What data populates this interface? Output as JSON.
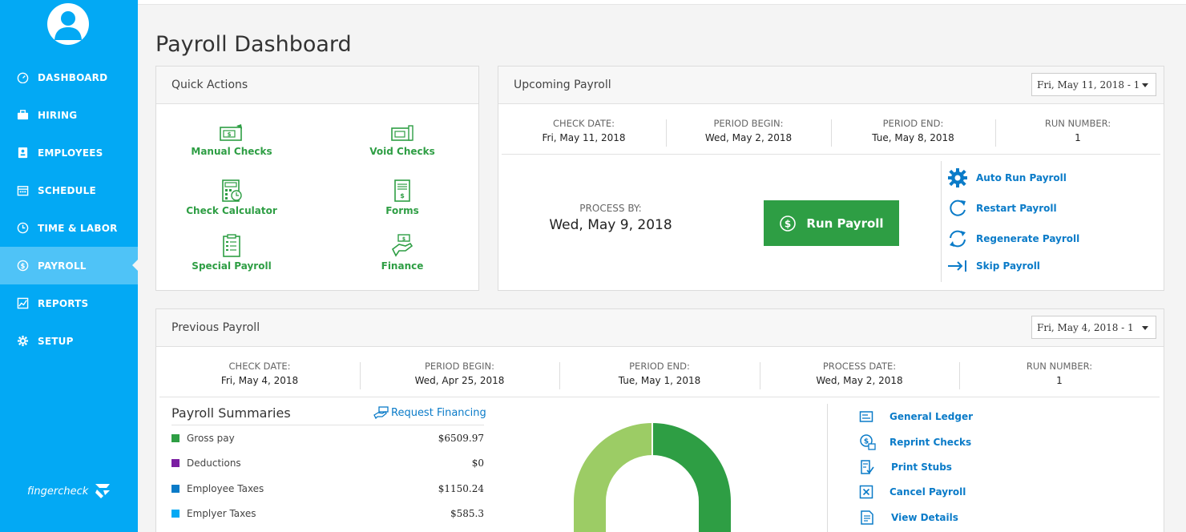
{
  "sidebar": {
    "items": [
      {
        "label": "DASHBOARD",
        "icon": "gauge-icon"
      },
      {
        "label": "HIRING",
        "icon": "briefcase-icon"
      },
      {
        "label": "EMPLOYEES",
        "icon": "id-card-icon"
      },
      {
        "label": "SCHEDULE",
        "icon": "calendar-icon"
      },
      {
        "label": "TIME & LABOR",
        "icon": "clock-icon"
      },
      {
        "label": "PAYROLL",
        "icon": "dollar-icon",
        "active": true
      },
      {
        "label": "REPORTS",
        "icon": "chart-icon"
      },
      {
        "label": "SETUP",
        "icon": "gear-icon"
      }
    ],
    "brand": "fingercheck"
  },
  "page_title": "Payroll Dashboard",
  "quick_actions": {
    "title": "Quick Actions",
    "items": [
      "Manual Checks",
      "Void Checks",
      "Check Calculator",
      "Forms",
      "Special Payroll",
      "Finance"
    ]
  },
  "upcoming": {
    "title": "Upcoming Payroll",
    "select": "Fri, May 11, 2018 - 1",
    "check_date_label": "CHECK DATE:",
    "check_date": "Fri, May 11, 2018",
    "period_begin_label": "PERIOD BEGIN:",
    "period_begin": "Wed, May 2, 2018",
    "period_end_label": "PERIOD END:",
    "period_end": "Tue, May 8, 2018",
    "run_number_label": "RUN NUMBER:",
    "run_number": "1",
    "process_by_label": "PROCESS BY:",
    "process_by": "Wed, May 9, 2018",
    "run_button": "Run Payroll",
    "actions": [
      "Auto Run Payroll",
      "Restart Payroll",
      "Regenerate Payroll",
      "Skip Payroll"
    ]
  },
  "previous": {
    "title": "Previous Payroll",
    "select": "Fri, May 4, 2018 - 1",
    "check_date_label": "CHECK DATE:",
    "check_date": "Fri, May 4, 2018",
    "period_begin_label": "PERIOD BEGIN:",
    "period_begin": "Wed, Apr 25, 2018",
    "period_end_label": "PERIOD END:",
    "period_end": "Tue, May 1, 2018",
    "process_date_label": "PROCESS DATE:",
    "process_date": "Wed, May 2, 2018",
    "run_number_label": "RUN NUMBER:",
    "run_number": "1",
    "summaries_title": "Payroll Summaries",
    "request_financing": "Request Financing",
    "summaries": [
      {
        "label": "Gross pay",
        "amount": "$6509.97",
        "color": "#2e9e44"
      },
      {
        "label": "Deductions",
        "amount": "$0",
        "color": "#7b1fa2"
      },
      {
        "label": "Employee Taxes",
        "amount": "$1150.24",
        "color": "#0a7bc8"
      },
      {
        "label": "Emplyer Taxes",
        "amount": "$585.3",
        "color": "#03a9f4"
      }
    ],
    "actions": [
      "General Ledger",
      "Reprint Checks",
      "Print Stubs",
      "Cancel Payroll",
      "View Details"
    ]
  },
  "colors": {
    "sidebar": "#03a9f4",
    "accent_green": "#2e9e44",
    "link_blue": "#0a7bc8"
  }
}
